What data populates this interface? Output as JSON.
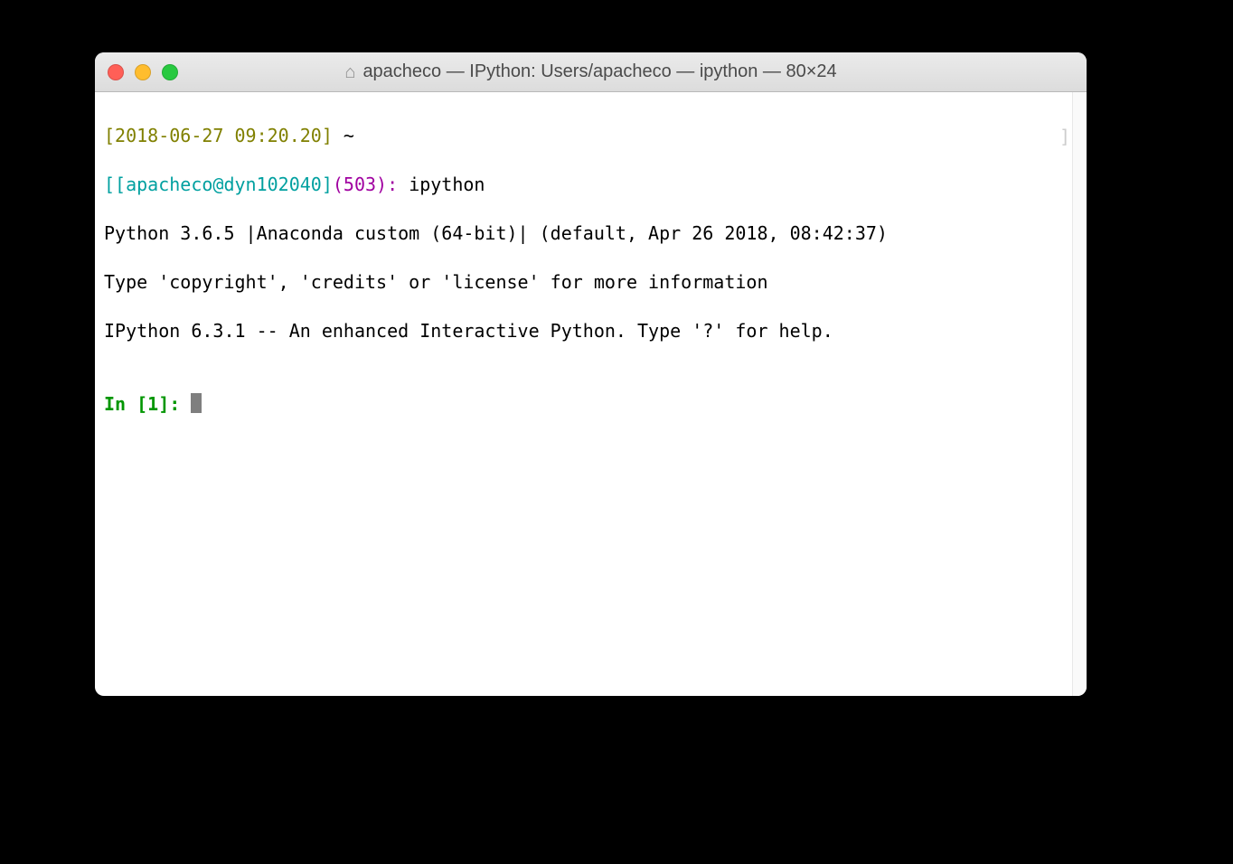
{
  "window": {
    "title": "apacheco — IPython: Users/apacheco — ipython — 80×24"
  },
  "shell_prompt": {
    "timestamp": "[2018-06-27 09:20.20]",
    "cwd_tilde": "~",
    "open_bracket": "[",
    "user_host": "[apacheco@dyn102040]",
    "seq": "(503)",
    "colon_space": ": ",
    "command": "ipython"
  },
  "banner": {
    "line1": "Python 3.6.5 |Anaconda custom (64-bit)| (default, Apr 26 2018, 08:42:37)",
    "line2": "Type 'copyright', 'credits' or 'license' for more information",
    "line3": "IPython 6.3.1 -- An enhanced Interactive Python. Type '?' for help."
  },
  "ipython_prompt": {
    "prefix": "In [",
    "num": "1",
    "suffix": "]: "
  },
  "decor": {
    "right_bracket": "]"
  }
}
